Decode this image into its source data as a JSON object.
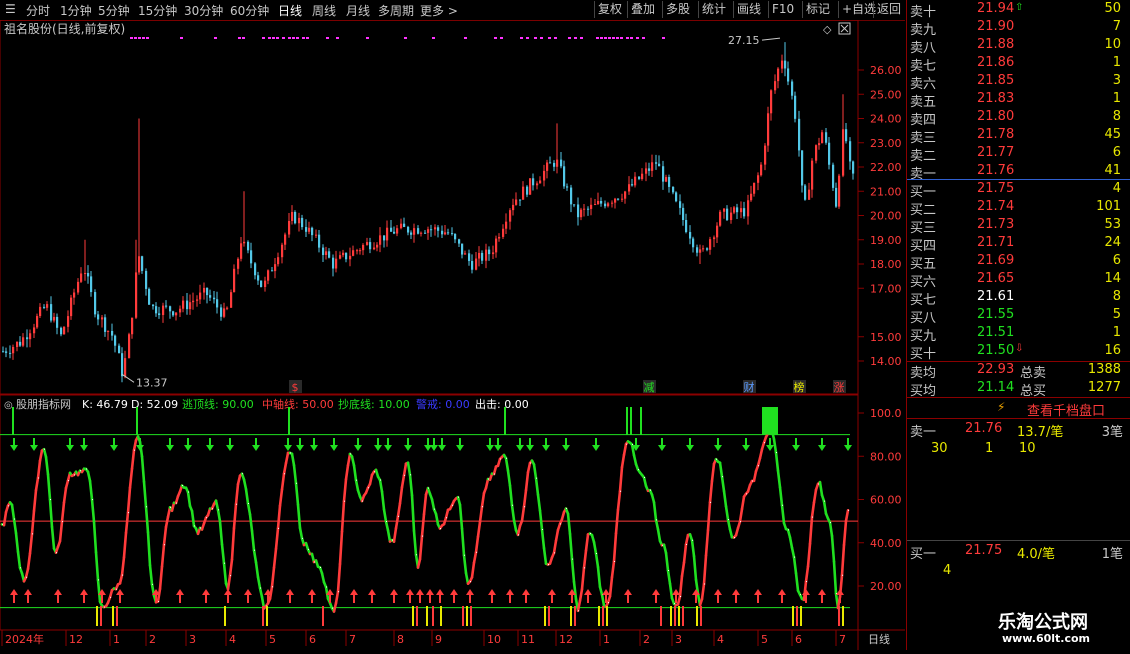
{
  "toolbar": {
    "periods": [
      "分时",
      "1分钟",
      "5分钟",
      "15分钟",
      "30分钟",
      "60分钟",
      "日线",
      "周线",
      "月线",
      "多周期",
      "更多 >"
    ],
    "active_period": "日线",
    "buttons": [
      "复权",
      "叠加",
      "多股",
      "统计",
      "画线",
      "F10",
      "标记",
      "+自选",
      "返回"
    ]
  },
  "chart": {
    "stock_title": "祖名股份(日线,前复权)",
    "high_label": "27.15",
    "low_label": "13.37",
    "price_ticks": [
      "26.00",
      "25.00",
      "24.00",
      "23.00",
      "22.00",
      "21.00",
      "20.00",
      "19.00",
      "18.00",
      "17.00",
      "15.00",
      "14.00"
    ],
    "price_tick_values": [
      26,
      25,
      24,
      23,
      22,
      21,
      20,
      19,
      18,
      17,
      15,
      14
    ],
    "event_markers": [
      {
        "text": "$",
        "color": "#ff3b3b"
      },
      {
        "text": "减",
        "color": "#20e020"
      },
      {
        "text": "财",
        "color": "#5b9bff"
      },
      {
        "text": "榜",
        "color": "#e8e800"
      },
      {
        "text": "涨",
        "color": "#ff3b3b"
      }
    ]
  },
  "indicator": {
    "name": "股朋指标网",
    "k_label": "K: 46.79",
    "d_label": "D: 52.09",
    "top_line": "逃顶线: 90.00",
    "mid_line": "中轴线: 50.00",
    "bottom_line": "抄底线: 10.00",
    "warn_label": "警戒: 0.00",
    "exit_label": "出击: 0.00",
    "ticks": [
      "100.0",
      "80.00",
      "60.00",
      "40.00",
      "20.00"
    ],
    "tick_values": [
      100,
      80,
      60,
      40,
      20
    ],
    "colors": {
      "top": "#ffffff",
      "mid": "#ff3b3b",
      "bottom": "#20e020",
      "warn": "#3a3aff",
      "exit": "#ffffff"
    }
  },
  "date_axis": {
    "labels": [
      "2024年",
      "12",
      "1",
      "2",
      "3",
      "4",
      "5",
      "6",
      "7",
      "8",
      "9",
      "10",
      "11",
      "12",
      "1",
      "2",
      "3",
      "4",
      "5",
      "6",
      "7"
    ],
    "period": "日线"
  },
  "quote": {
    "sell": [
      {
        "label": "卖十",
        "price": "21.94",
        "vol": "50",
        "color": "red"
      },
      {
        "label": "卖九",
        "price": "21.90",
        "vol": "7",
        "color": "red"
      },
      {
        "label": "卖八",
        "price": "21.88",
        "vol": "10",
        "color": "red"
      },
      {
        "label": "卖七",
        "price": "21.86",
        "vol": "1",
        "color": "red"
      },
      {
        "label": "卖六",
        "price": "21.85",
        "vol": "3",
        "color": "red"
      },
      {
        "label": "卖五",
        "price": "21.83",
        "vol": "1",
        "color": "red"
      },
      {
        "label": "卖四",
        "price": "21.80",
        "vol": "8",
        "color": "red"
      },
      {
        "label": "卖三",
        "price": "21.78",
        "vol": "45",
        "color": "red"
      },
      {
        "label": "卖二",
        "price": "21.77",
        "vol": "6",
        "color": "red"
      },
      {
        "label": "卖一",
        "price": "21.76",
        "vol": "41",
        "color": "red"
      }
    ],
    "buy": [
      {
        "label": "买一",
        "price": "21.75",
        "vol": "4",
        "color": "red"
      },
      {
        "label": "买二",
        "price": "21.74",
        "vol": "101",
        "color": "red"
      },
      {
        "label": "买三",
        "price": "21.73",
        "vol": "53",
        "color": "red"
      },
      {
        "label": "买四",
        "price": "21.71",
        "vol": "24",
        "color": "red"
      },
      {
        "label": "买五",
        "price": "21.69",
        "vol": "6",
        "color": "red"
      },
      {
        "label": "买六",
        "price": "21.65",
        "vol": "14",
        "color": "red"
      },
      {
        "label": "买七",
        "price": "21.61",
        "vol": "8",
        "color": "wht"
      },
      {
        "label": "买八",
        "price": "21.55",
        "vol": "5",
        "color": "grn"
      },
      {
        "label": "买九",
        "price": "21.51",
        "vol": "1",
        "color": "grn"
      },
      {
        "label": "买十",
        "price": "21.50",
        "vol": "16",
        "color": "grn"
      }
    ],
    "avg_sell_label": "卖均",
    "avg_sell": "22.93",
    "total_sell_label": "总卖",
    "total_sell": "1388",
    "avg_buy_label": "买均",
    "avg_buy": "21.14",
    "total_buy_label": "总买",
    "total_buy": "1277",
    "thousand_link": "查看千档盘口",
    "sell1_label": "卖一",
    "sell1_price": "21.76",
    "sell1_vol": "13.7/笔",
    "sell1_count": "3笔",
    "sell1_detail": [
      "30",
      "1",
      "10"
    ],
    "buy1_label": "买一",
    "buy1_price": "21.75",
    "buy1_vol": "4.0/笔",
    "buy1_count": "1笔",
    "buy1_detail": [
      "4"
    ]
  },
  "watermark": {
    "title": "乐淘公式网",
    "url": "www.60lt.com"
  }
}
